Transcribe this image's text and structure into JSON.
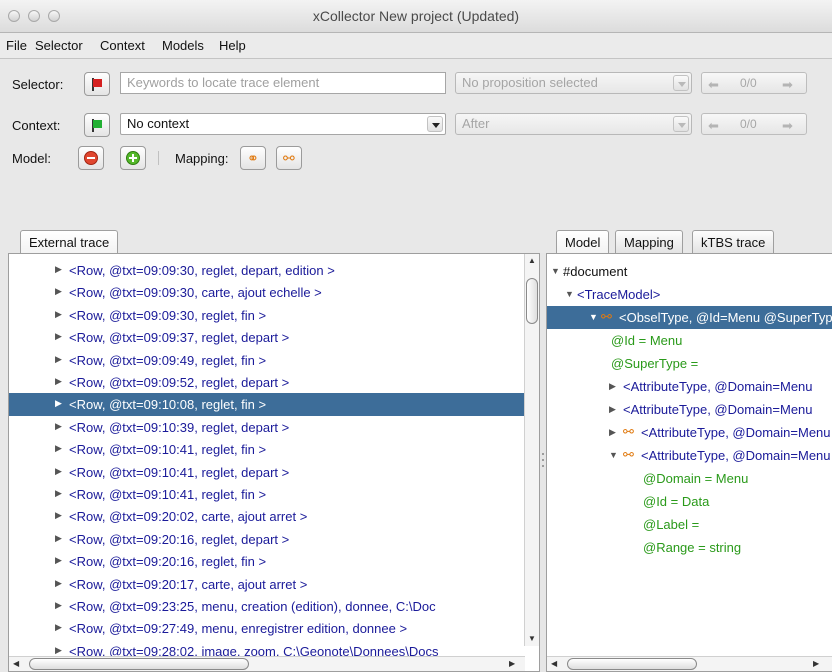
{
  "window": {
    "title": "xCollector New project (Updated)"
  },
  "menu": [
    "File",
    "Selector",
    "Context",
    "Models",
    "Help"
  ],
  "toolbar": {
    "selector_label": "Selector:",
    "selector_placeholder": "Keywords to locate trace element",
    "selector_proposition": "No proposition selected",
    "selector_count": "0/0",
    "context_label": "Context:",
    "context_value": "No context",
    "context_position": "After",
    "context_count": "0/0",
    "model_label": "Model:",
    "mapping_label": "Mapping:"
  },
  "left_tabs": [
    "External trace"
  ],
  "right_tabs": [
    "Model",
    "Mapping",
    "kTBS trace"
  ],
  "trace_rows": [
    "<Row, @txt=09:09:30, reglet, depart, edition >",
    "<Row, @txt=09:09:30, carte, ajout echelle >",
    "<Row, @txt=09:09:30, reglet, fin >",
    "<Row, @txt=09:09:37, reglet, depart >",
    "<Row, @txt=09:09:49, reglet, fin >",
    "<Row, @txt=09:09:52, reglet, depart >",
    "<Row, @txt=09:10:08, reglet, fin >",
    "<Row, @txt=09:10:39, reglet, depart >",
    "<Row, @txt=09:10:41, reglet, fin >",
    "<Row, @txt=09:10:41, reglet, depart >",
    "<Row, @txt=09:10:41, reglet, fin >",
    "<Row, @txt=09:20:02, carte, ajout arret >",
    "<Row, @txt=09:20:16, reglet, depart >",
    "<Row, @txt=09:20:16, reglet, fin >",
    "<Row, @txt=09:20:17, carte, ajout arret >",
    "<Row, @txt=09:23:25, menu, creation (edition), donnee, C:\\Doc",
    "<Row, @txt=09:27:49, menu, enregistrer edition, donnee >",
    "<Row, @txt=09:28:02, image, zoom, C:\\Geonote\\Donnees\\Docs"
  ],
  "selected_trace_index": 6,
  "model_tree": [
    {
      "text": "#document",
      "kind": "black"
    },
    {
      "text": "<TraceModel>",
      "kind": "blue"
    },
    {
      "text": "<ObselType, @Id=Menu @SuperType",
      "kind": "blue"
    },
    {
      "text": "@Id = Menu",
      "kind": "green"
    },
    {
      "text": "@SuperType =",
      "kind": "green"
    },
    {
      "text": "<AttributeType, @Domain=Menu",
      "kind": "blue"
    },
    {
      "text": "<AttributeType, @Domain=Menu",
      "kind": "blue"
    },
    {
      "text": "<AttributeType, @Domain=Menu",
      "kind": "blue"
    },
    {
      "text": "<AttributeType, @Domain=Menu",
      "kind": "blue"
    },
    {
      "text": "@Domain = Menu",
      "kind": "green"
    },
    {
      "text": "@Id = Data",
      "kind": "green"
    },
    {
      "text": "@Label =",
      "kind": "green"
    },
    {
      "text": "@Range = string",
      "kind": "green"
    }
  ]
}
